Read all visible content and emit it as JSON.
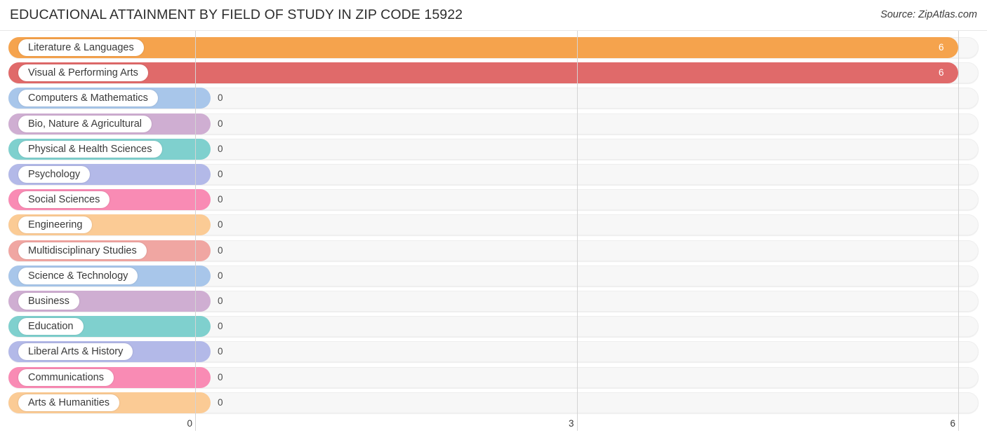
{
  "header": {
    "title": "EDUCATIONAL ATTAINMENT BY FIELD OF STUDY IN ZIP CODE 15922",
    "source": "Source: ZipAtlas.com"
  },
  "chart_data": {
    "type": "bar",
    "orientation": "horizontal",
    "title": "EDUCATIONAL ATTAINMENT BY FIELD OF STUDY IN ZIP CODE 15922",
    "xlabel": "",
    "ylabel": "",
    "xlim": [
      0,
      6
    ],
    "grid": true,
    "legend": false,
    "xticks": [
      "0",
      "3",
      "6"
    ],
    "xtick_values": [
      0,
      3,
      6
    ],
    "categories": [
      "Literature & Languages",
      "Visual & Performing Arts",
      "Computers & Mathematics",
      "Bio, Nature & Agricultural",
      "Physical & Health Sciences",
      "Psychology",
      "Social Sciences",
      "Engineering",
      "Multidisciplinary Studies",
      "Science & Technology",
      "Business",
      "Education",
      "Liberal Arts & History",
      "Communications",
      "Arts & Humanities"
    ],
    "values": [
      6,
      6,
      0,
      0,
      0,
      0,
      0,
      0,
      0,
      0,
      0,
      0,
      0,
      0,
      0
    ],
    "value_labels": [
      "6",
      "6",
      "0",
      "0",
      "0",
      "0",
      "0",
      "0",
      "0",
      "0",
      "0",
      "0",
      "0",
      "0",
      "0"
    ],
    "colors": [
      "#f5a council",
      "#e06a6a",
      "#a8c6ea",
      "#cfaed2",
      "#7fd0ce",
      "#b3b9e8",
      "#f98bb4",
      "#fbcb95",
      "#f0a6a2",
      "#a8c6ea",
      "#cfaed2",
      "#7fd0ce",
      "#b3b9e8",
      "#f98bb4",
      "#fbcb95"
    ]
  },
  "bars": [
    {
      "label": "Literature & Languages",
      "value": "6",
      "color": "#f5a council",
      "value_inside": true
    },
    {
      "label": "Visual & Performing Arts",
      "value": "6",
      "color": "#e06a6a",
      "value_inside": true
    },
    {
      "label": "Computers & Mathematics",
      "value": "0",
      "color": "#a8c6ea",
      "value_inside": false
    },
    {
      "label": "Bio, Nature & Agricultural",
      "value": "0",
      "color": "#cfaed2",
      "value_inside": false
    },
    {
      "label": "Physical & Health Sciences",
      "value": "0",
      "color": "#7fd0ce",
      "value_inside": false
    },
    {
      "label": "Psychology",
      "value": "0",
      "color": "#b3b9e8",
      "value_inside": false
    },
    {
      "label": "Social Sciences",
      "value": "0",
      "color": "#f98bb4",
      "value_inside": false
    },
    {
      "label": "Engineering",
      "value": "0",
      "color": "#fbcb95",
      "value_inside": false
    },
    {
      "label": "Multidisciplinary Studies",
      "value": "0",
      "color": "#f0a6a2",
      "value_inside": false
    },
    {
      "label": "Science & Technology",
      "value": "0",
      "color": "#a8c6ea",
      "value_inside": false
    },
    {
      "label": "Business",
      "value": "0",
      "color": "#cfaed2",
      "value_inside": false
    },
    {
      "label": "Education",
      "value": "0",
      "color": "#7fd0ce",
      "value_inside": false
    },
    {
      "label": "Liberal Arts & History",
      "value": "0",
      "color": "#b3b9e8",
      "value_inside": false
    },
    {
      "label": "Communications",
      "value": "0",
      "color": "#f98bb4",
      "value_inside": false
    },
    {
      "label": "Arts & Humanities",
      "value": "0",
      "color": "#fbcb95",
      "value_inside": false
    }
  ],
  "axis": {
    "ticks": [
      "0",
      "3",
      "6"
    ]
  }
}
